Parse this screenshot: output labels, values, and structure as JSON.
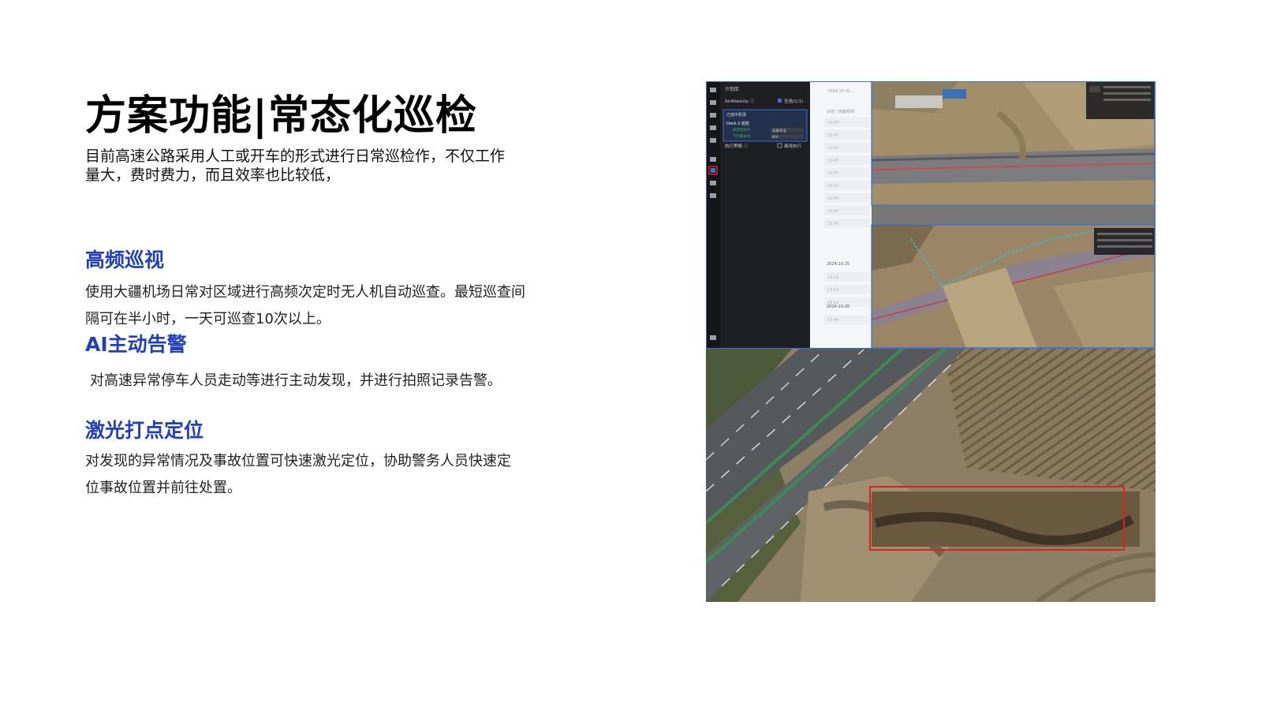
{
  "slide": {
    "title": "方案功能|常态化巡检",
    "intro": "目前高速公路采用人工或开车的形式进行日常巡检作，不仅工作量大，费时费力，而且效率也比较低，",
    "sections": [
      {
        "heading": "高频巡视",
        "body": "使用大疆机场日常对区域进行高频次定时无人机自动巡查。最短巡查间隔可在半小时，一天可巡查10次以上。"
      },
      {
        "heading": "AI主动告警",
        "body": "对高速异常停车人员走动等进行主动发现，并进行拍照记录告警。"
      },
      {
        "heading": "激光打点定位",
        "body": "对发现的异常情况及事故位置可快速激光定位，协助警务人员快速定位事故位置并前往处置。"
      }
    ]
  },
  "screenshot": {
    "panel_title": "计划库",
    "row1_label": "AirWakeUp ⓘ",
    "row1_check": "全选(1/1)",
    "card_title": "已选中机场",
    "card_name": "Dock 2 巡检",
    "card_status1": "机场空闲中",
    "card_status1_val": "设备作业",
    "card_status2": "飞行器关机",
    "card_status2_val": "N/A",
    "row2_label": "执行策略 ⓘ",
    "row2_check": "离线执行",
    "timeline_header": "2024-10-31 ...",
    "timeline_sub": "计划 | 完成时间",
    "timeline_dates": [
      "2024-10-25",
      "2024-10-28"
    ],
    "timeline_times": [
      "13:47",
      "13:47",
      "13:47",
      "13:47",
      "13:47",
      "13:47",
      "13:47",
      "13:47",
      "13:47",
      "13:12",
      "13:12",
      "13:12",
      "13:40"
    ]
  },
  "colors": {
    "heading_blue": "#1f3fbf",
    "title_black": "#000000",
    "alert_red": "#e02020",
    "frame_blue": "#3a6fd8"
  }
}
